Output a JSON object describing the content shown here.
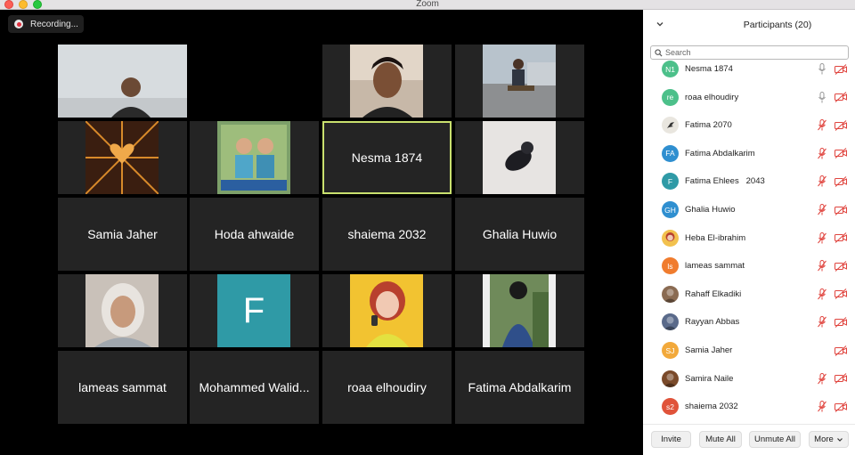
{
  "window": {
    "title": "Zoom"
  },
  "recording": {
    "label": "Recording..."
  },
  "gallery": {
    "tiles": [
      {
        "name": "",
        "type": "photo",
        "photo": "man-office"
      },
      {
        "name": "",
        "type": "black"
      },
      {
        "name": "",
        "type": "photo",
        "photo": "man-selfie"
      },
      {
        "name": "",
        "type": "photo",
        "photo": "man-street"
      },
      {
        "name": "",
        "type": "photo",
        "photo": "heart-art"
      },
      {
        "name": "",
        "type": "photo",
        "photo": "children"
      },
      {
        "name": "Nesma 1874",
        "type": "name",
        "speaking": true
      },
      {
        "name": "",
        "type": "photo",
        "photo": "blurred-figure"
      },
      {
        "name": "Samia Jaher",
        "type": "name"
      },
      {
        "name": "Hoda ahwaide",
        "type": "name"
      },
      {
        "name": "shaiema 2032",
        "type": "name"
      },
      {
        "name": "Ghalia Huwio",
        "type": "name"
      },
      {
        "name": "",
        "type": "photo",
        "photo": "woman-hijab"
      },
      {
        "name": "F",
        "type": "letter",
        "color": "#2f9aa6"
      },
      {
        "name": "",
        "type": "photo",
        "photo": "cartoon-girl"
      },
      {
        "name": "",
        "type": "photo",
        "photo": "person-plants"
      },
      {
        "name": "lameas sammat",
        "type": "name"
      },
      {
        "name": "Mohammed Walid...",
        "type": "name"
      },
      {
        "name": "roaa elhoudiry",
        "type": "name"
      },
      {
        "name": "Fatima Abdalkarim",
        "type": "name"
      }
    ]
  },
  "participants": {
    "title": "Participants (20)",
    "search_placeholder": "Search",
    "list": [
      {
        "initials": "N1",
        "name": "Nesma 1874",
        "avatar_color": "#4cc08a",
        "mic": "on",
        "video": "off"
      },
      {
        "initials": "re",
        "name": "roaa elhoudiry",
        "avatar_color": "#4cc08a",
        "mic": "on",
        "video": "off"
      },
      {
        "initials": "",
        "name": "Fatima 2070",
        "avatar_color": "#e9e6df",
        "avatar_icon": "bird-icon",
        "mic": "muted",
        "video": "off"
      },
      {
        "initials": "FA",
        "name": "Fatima Abdalkarim",
        "avatar_color": "#2f8fd0",
        "mic": "muted",
        "video": "off"
      },
      {
        "initials": "F",
        "name": "Fatima Ehlees   2043",
        "avatar_color": "#2f9aa6",
        "mic": "muted",
        "video": "off"
      },
      {
        "initials": "GH",
        "name": "Ghalia Huwio",
        "avatar_color": "#2f8fd0",
        "mic": "muted",
        "video": "off"
      },
      {
        "initials": "",
        "name": "Heba El-ibrahim",
        "avatar_color": "#f2c14e",
        "avatar_icon": "cartoon-avatar-icon",
        "mic": "muted",
        "video": "off"
      },
      {
        "initials": "ls",
        "name": "lameas sammat",
        "avatar_color": "#f07c2e",
        "mic": "muted",
        "video": "off"
      },
      {
        "initials": "",
        "name": "Rahaff Elkadiki",
        "avatar_color": "#8a6b52",
        "avatar_icon": "photo-avatar-icon",
        "mic": "muted",
        "video": "off"
      },
      {
        "initials": "",
        "name": "Rayyan Abbas",
        "avatar_color": "#5a6a8a",
        "avatar_icon": "photo-avatar-icon",
        "mic": "muted",
        "video": "off"
      },
      {
        "initials": "SJ",
        "name": "Samia Jaher",
        "avatar_color": "#f2a93b",
        "mic": "none",
        "video": "off"
      },
      {
        "initials": "",
        "name": "Samira Naile",
        "avatar_color": "#7a4a2a",
        "avatar_icon": "photo-avatar-icon",
        "mic": "muted",
        "video": "off"
      },
      {
        "initials": "s2",
        "name": "shaiema 2032",
        "avatar_color": "#e0533a",
        "mic": "muted",
        "video": "off"
      }
    ]
  },
  "footer": {
    "invite": "Invite",
    "mute_all": "Mute All",
    "unmute_all": "Unmute All",
    "more": "More"
  },
  "colors": {
    "muted_red": "#e0443e",
    "speaking_border": "#c9e06e",
    "tile_bg": "#242424"
  }
}
